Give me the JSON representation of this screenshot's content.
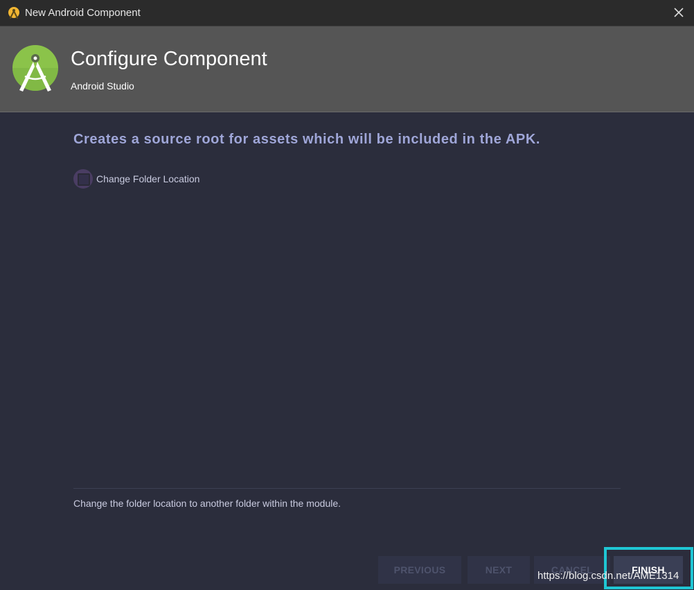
{
  "window": {
    "title": "New Android Component"
  },
  "header": {
    "heading": "Configure Component",
    "subheading": "Android Studio"
  },
  "main": {
    "description": "Creates a source root for assets which will be included in the APK.",
    "checkbox_label": "Change Folder Location",
    "checkbox_checked": false,
    "hint": "Change the folder location to another folder within the module."
  },
  "buttons": {
    "previous": "PREVIOUS",
    "next": "NEXT",
    "cancel": "CANCEL",
    "finish": "FINISH"
  },
  "watermark": "https://blog.csdn.net/AME1314",
  "colors": {
    "accent_highlight": "#1fc6d4",
    "description_text": "#9fa6d8",
    "header_bg": "#555555",
    "body_bg": "#2b2d3c",
    "android_green": "#8bc34a"
  },
  "icons": {
    "app": "android-studio-icon",
    "logo": "android-studio-logo",
    "close": "close-icon"
  }
}
